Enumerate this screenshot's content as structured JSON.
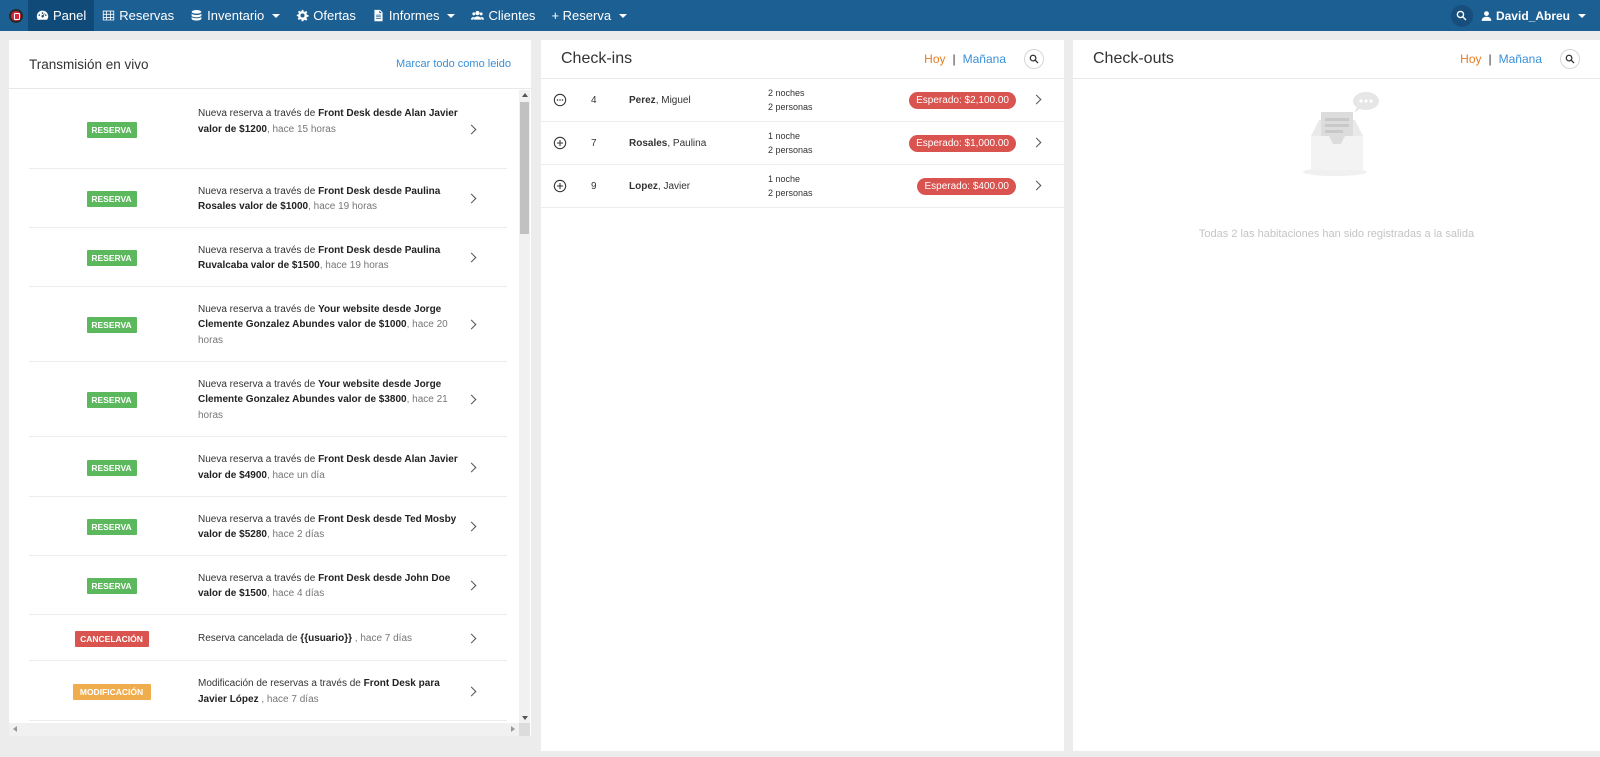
{
  "nav": {
    "items": [
      {
        "label": "Panel",
        "icon": "dashboard-icon",
        "active": true,
        "dropdown": false
      },
      {
        "label": "Reservas",
        "icon": "grid-icon",
        "active": false,
        "dropdown": false
      },
      {
        "label": "Inventario",
        "icon": "database-icon",
        "active": false,
        "dropdown": true
      },
      {
        "label": "Ofertas",
        "icon": "gear-icon",
        "active": false,
        "dropdown": false
      },
      {
        "label": "Informes",
        "icon": "file-icon",
        "active": false,
        "dropdown": true
      },
      {
        "label": "Clientes",
        "icon": "users-icon",
        "active": false,
        "dropdown": false
      },
      {
        "label": "+ Reserva",
        "icon": "",
        "active": false,
        "dropdown": true
      }
    ],
    "user": "David_Abreu"
  },
  "live": {
    "title": "Transmisión en vivo",
    "mark_all": "Marcar todo como leido",
    "items": [
      {
        "badge": "RESERVA",
        "type": "reserva",
        "text": [
          [
            "Nueva reserva a través de ",
            ""
          ],
          [
            "Front Desk desde Alan Javier valor de $1200",
            "hl"
          ],
          [
            ", hace 15 horas",
            "tm"
          ]
        ]
      },
      {
        "badge": "RESERVA",
        "type": "reserva",
        "text": [
          [
            "Nueva reserva a través de ",
            ""
          ],
          [
            "Front Desk desde Paulina Rosales valor de $1000",
            "hl"
          ],
          [
            ", hace 19 horas",
            "tm"
          ]
        ]
      },
      {
        "badge": "RESERVA",
        "type": "reserva",
        "text": [
          [
            "Nueva reserva a través de ",
            ""
          ],
          [
            "Front Desk desde Paulina Ruvalcaba valor de $1500",
            "hl"
          ],
          [
            ", hace 19 horas",
            "tm"
          ]
        ]
      },
      {
        "badge": "RESERVA",
        "type": "reserva",
        "text": [
          [
            "Nueva reserva a través de ",
            ""
          ],
          [
            "Your website desde Jorge Clemente Gonzalez Abundes valor de $1000",
            "hl"
          ],
          [
            ", hace 20 horas",
            "tm"
          ]
        ]
      },
      {
        "badge": "RESERVA",
        "type": "reserva",
        "text": [
          [
            "Nueva reserva a través de ",
            ""
          ],
          [
            "Your website desde Jorge Clemente Gonzalez Abundes valor de $3800",
            "hl"
          ],
          [
            ", hace 21 horas",
            "tm"
          ]
        ]
      },
      {
        "badge": "RESERVA",
        "type": "reserva",
        "text": [
          [
            "Nueva reserva a través de ",
            ""
          ],
          [
            "Front Desk desde Alan Javier valor de $4900",
            "hl"
          ],
          [
            ", hace un día",
            "tm"
          ]
        ]
      },
      {
        "badge": "RESERVA",
        "type": "reserva",
        "text": [
          [
            "Nueva reserva a través de ",
            ""
          ],
          [
            "Front Desk desde Ted Mosby valor de $5280",
            "hl"
          ],
          [
            ", hace 2 días",
            "tm"
          ]
        ]
      },
      {
        "badge": "RESERVA",
        "type": "reserva",
        "text": [
          [
            "Nueva reserva a través de ",
            ""
          ],
          [
            "Front Desk desde John Doe valor de $1500",
            "hl"
          ],
          [
            ", hace 4 días",
            "tm"
          ]
        ]
      },
      {
        "badge": "CANCELACIÓN",
        "type": "cancel",
        "text": [
          [
            "Reserva cancelada de ",
            ""
          ],
          [
            "{{usuario}}",
            "hl"
          ],
          [
            " , hace 7 días",
            "tm"
          ]
        ]
      },
      {
        "badge": "MODIFICACIÓN",
        "type": "modif",
        "text": [
          [
            "Modificación de reservas a través de ",
            ""
          ],
          [
            "Front Desk para Javier López",
            "hl"
          ],
          [
            " , hace 7 días",
            "tm"
          ]
        ]
      },
      {
        "badge": "",
        "type": "cancel",
        "text": []
      }
    ]
  },
  "checkins": {
    "title": "Check-ins",
    "today": "Hoy",
    "sep": "|",
    "tomorrow": "Mañana",
    "rows": [
      {
        "icon": "chat-icon",
        "room": "4",
        "last": "Perez",
        "first": ", Miguel",
        "nights": "2 noches",
        "people": "2 personas",
        "expected": "Esperado: $2,100.00"
      },
      {
        "icon": "plus-circle-icon",
        "room": "7",
        "last": "Rosales",
        "first": ", Paulina",
        "nights": "1 noche",
        "people": "2 personas",
        "expected": "Esperado: $1,000.00"
      },
      {
        "icon": "plus-circle-icon",
        "room": "9",
        "last": "Lopez",
        "first": ", Javier",
        "nights": "1 noche",
        "people": "2 personas",
        "expected": "Esperado: $400.00"
      }
    ]
  },
  "checkouts": {
    "title": "Check-outs",
    "today": "Hoy",
    "sep": "|",
    "tomorrow": "Mañana",
    "empty": "Todas 2 las habitaciones han sido registradas a la salida"
  },
  "colors": {
    "nav": "#1c5f93",
    "reserva": "#5cb85c",
    "cancel": "#d9534f",
    "modif": "#f0ad4e",
    "hoy": "#e67e22",
    "link": "#3a8fd8"
  }
}
